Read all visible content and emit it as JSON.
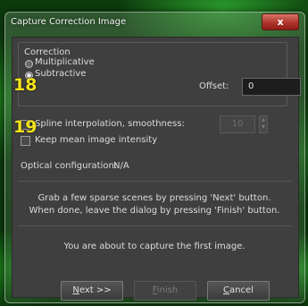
{
  "window": {
    "title": "Capture Correction Image",
    "close_glyph": "x"
  },
  "correction": {
    "group_label": "Correction",
    "options": [
      {
        "label": "Multiplicative",
        "selected": false
      },
      {
        "label": "Subtractive",
        "selected": true
      }
    ],
    "offset_label": "Offset:",
    "offset_value": "0"
  },
  "spline": {
    "label": "Spline interpolation, smoothness:",
    "checked": false,
    "smoothness_value": "10"
  },
  "keep_mean": {
    "label": "Keep mean image intensity",
    "checked": false
  },
  "optical": {
    "label": "Optical configuration:",
    "value": "N/A"
  },
  "instructions": {
    "line1": "Grab a few sparse scenes by pressing 'Next' button.",
    "line2": "When done, leave the dialog by pressing 'Finish' button."
  },
  "status": "You are about to capture the first image.",
  "annotations": [
    "18",
    "19"
  ],
  "buttons": {
    "next": {
      "mnemonic": "N",
      "rest": "ext >>"
    },
    "finish": {
      "mnemonic": "F",
      "rest": "inish"
    },
    "cancel": {
      "mnemonic": "C",
      "rest": "ancel"
    }
  },
  "icons": {
    "radio": "radio-button",
    "checkbox": "checkbox",
    "spin": "spin-arrows"
  }
}
